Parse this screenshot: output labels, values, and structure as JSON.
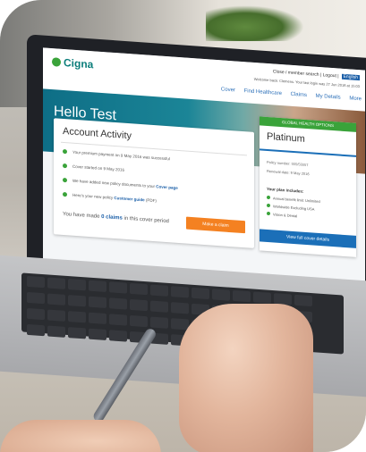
{
  "brand": {
    "name": "Cigna"
  },
  "header": {
    "utility_text": "Close / member search | Logout |",
    "language_label": "English",
    "welcome_text": "Welcome back: Clemens. Your last login was 27 Jun 2016 at 15:03",
    "nav": [
      "Cover",
      "Find Healthcare",
      "Claims",
      "My Details",
      "More"
    ]
  },
  "hero": {
    "greeting": "Hello Test"
  },
  "account_activity": {
    "title": "Account Activity",
    "items": [
      {
        "text": "Your premium payment on 9 May 2016 was successful"
      },
      {
        "text": "Cover started on 9 May 2016"
      },
      {
        "text": "We have added new policy documents to your ",
        "link": "Cover page"
      },
      {
        "text": "Here's your new policy ",
        "link": "Customer guide",
        "suffix": " (PDF)"
      }
    ],
    "claims_prefix": "You have made",
    "claims_count": "0 claims",
    "claims_suffix": "in this cover period",
    "make_claim_label": "Make a claim"
  },
  "plan": {
    "tag": "GLOBAL HEALTH OPTIONS",
    "name": "Platinum",
    "policy_number": "Policy number: 555/55557",
    "renewal_date": "Renewal date: 9 May 2016",
    "includes_label": "Your plan includes:",
    "includes": [
      "Annual benefit limit: Unlimited",
      "Worldwide Excluding USA",
      "Vision & Dental"
    ],
    "view_button": "View full cover details"
  },
  "colors": {
    "teal": "#0a7d7a",
    "green": "#3aa33a",
    "blue": "#1b6fb8",
    "orange": "#f48121"
  }
}
